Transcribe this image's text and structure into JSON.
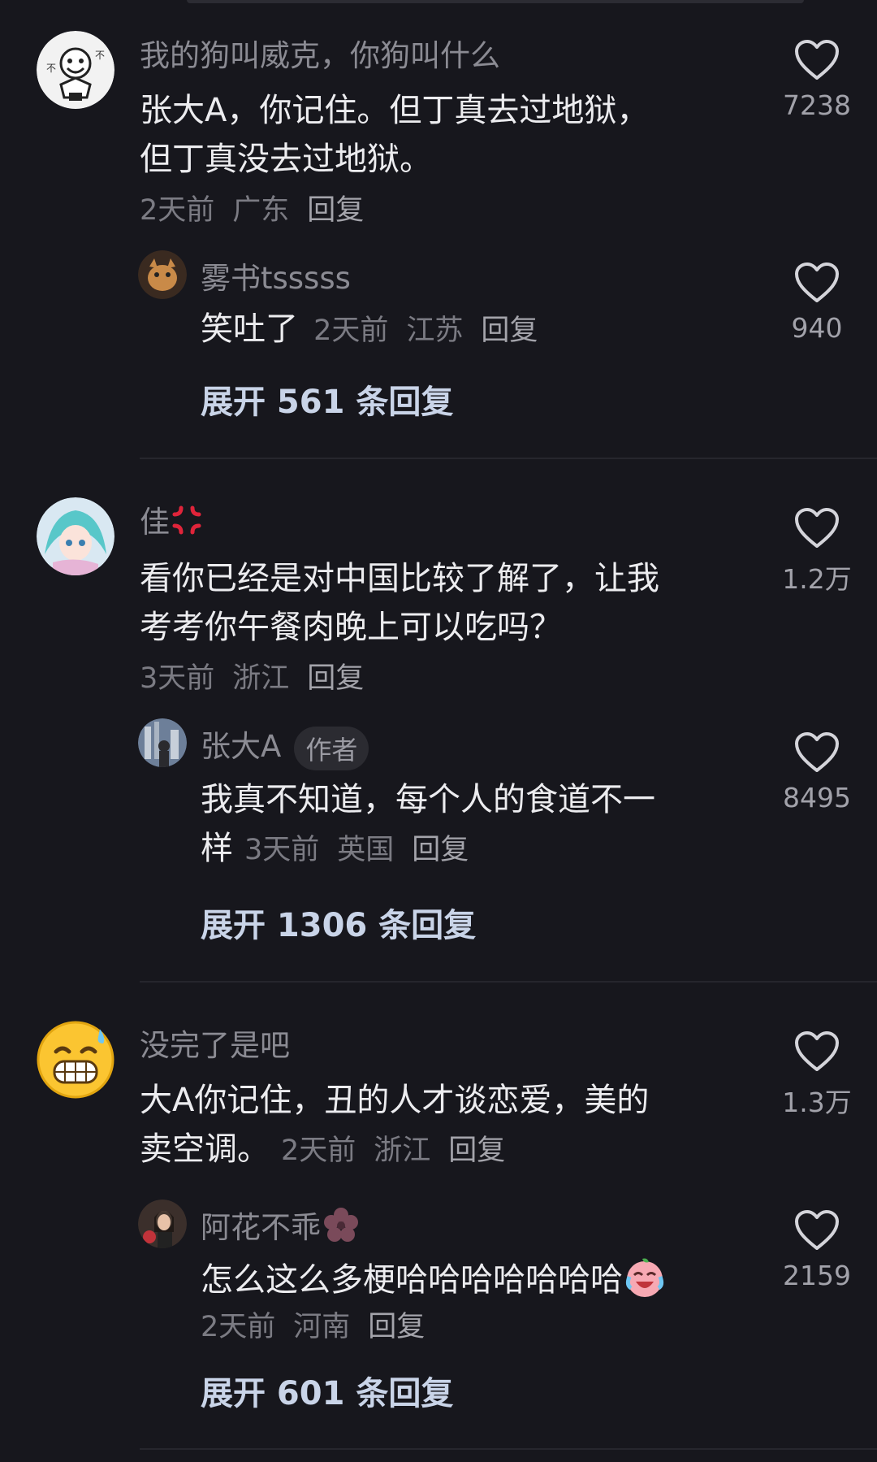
{
  "comments": [
    {
      "name": "我的狗叫威克，你狗叫什么",
      "text_line1": "张大A，你记住。但丁真去过地狱，",
      "text_line2": "但丁真没去过地狱。",
      "time": "2天前",
      "location": "广东",
      "reply_label": "回复",
      "likes": "7238",
      "reply": {
        "name": "雾书tsssss",
        "text": "笑吐了",
        "time": "2天前",
        "location": "江苏",
        "reply_label": "回复",
        "likes": "940"
      },
      "expand_label": "展开 561 条回复"
    },
    {
      "name": "佳",
      "text_line1": "看你已经是对中国比较了解了，让我",
      "text_line2": "考考你午餐肉晚上可以吃吗？",
      "time": "3天前",
      "location": "浙江",
      "reply_label": "回复",
      "likes": "1.2万",
      "reply": {
        "name": "张大A",
        "badge": "作者",
        "text_line1": "我真不知道，每个人的食道不一",
        "text_line2": "样",
        "time": "3天前",
        "location": "英国",
        "reply_label": "回复",
        "likes": "8495"
      },
      "expand_label": "展开 1306 条回复"
    },
    {
      "name": "没完了是吧",
      "text_line1": "大A你记住，丑的人才谈恋爱，美的",
      "text_line2": "卖空调。",
      "time": "2天前",
      "location": "浙江",
      "reply_label": "回复",
      "likes": "1.3万",
      "reply": {
        "name": "阿花不乖",
        "text": "怎么这么多梗哈哈哈哈哈哈哈",
        "time": "2天前",
        "location": "河南",
        "reply_label": "回复",
        "likes": "2159"
      },
      "expand_label": "展开 601 条回复"
    }
  ],
  "icons": {
    "like": "heart-outline-icon",
    "anger": "anger-emoji-icon",
    "flower": "flower-emoji-icon",
    "crying_laugh": "crying-laugh-emoji-icon"
  },
  "colors": {
    "background": "#17171d",
    "name": "#8b8b93",
    "text": "#ececef",
    "meta": "#7b7b83",
    "expand": "#c9d4e8"
  }
}
